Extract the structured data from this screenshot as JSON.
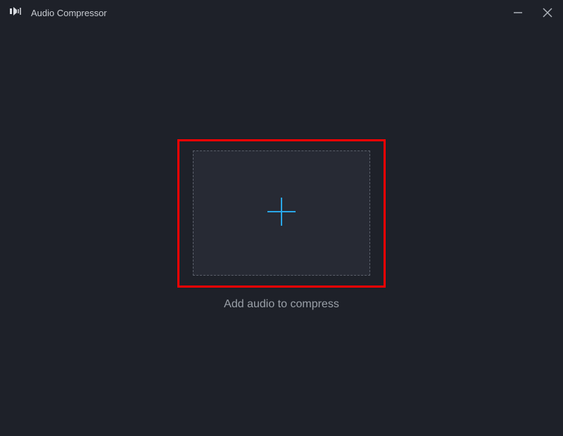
{
  "titlebar": {
    "title": "Audio Compressor"
  },
  "main": {
    "instruction": "Add audio to compress"
  }
}
